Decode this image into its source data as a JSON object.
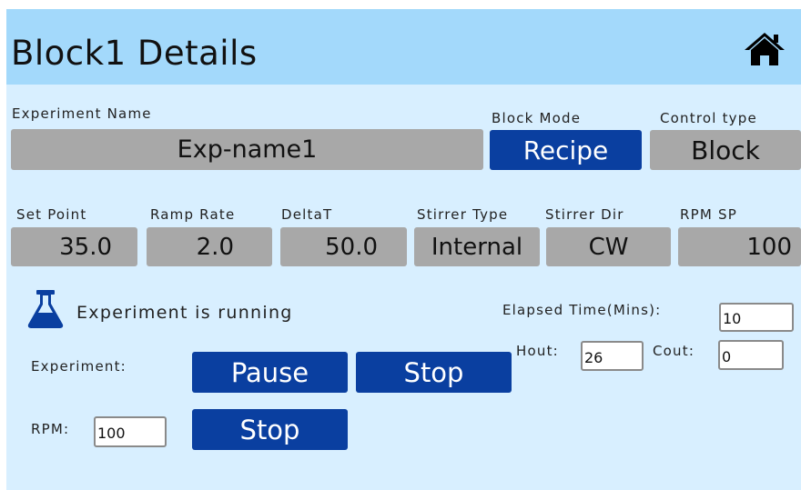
{
  "header": {
    "title": "Block1 Details"
  },
  "icons": {
    "home": "home-icon",
    "flask": "flask-icon"
  },
  "labels": {
    "experiment_name": "Experiment Name",
    "block_mode": "Block Mode",
    "control_type": "Control type",
    "set_point": "Set Point",
    "ramp_rate": "Ramp Rate",
    "delta_t": "DeltaT",
    "stirrer_type": "Stirrer Type",
    "stirrer_dir": "Stirrer Dir",
    "rpm_sp": "RPM SP",
    "elapsed_time": "Elapsed Time(Mins):",
    "hout": "Hout:",
    "cout": "Cout:",
    "experiment": "Experiment:",
    "rpm": "RPM:"
  },
  "values": {
    "experiment_name": "Exp-name1",
    "block_mode": "Recipe",
    "control_type": "Block",
    "set_point": "35.0",
    "ramp_rate": "2.0",
    "delta_t": "50.0",
    "stirrer_type": "Internal",
    "stirrer_dir": "CW",
    "rpm_sp": "100"
  },
  "status": {
    "text": "Experiment is running"
  },
  "inputs": {
    "elapsed_time": "10",
    "hout": "26",
    "cout": "0",
    "rpm": "100"
  },
  "buttons": {
    "pause": "Pause",
    "stop_experiment": "Stop",
    "stop_rpm": "Stop"
  },
  "colors": {
    "header_bg": "#a3d9fb",
    "page_bg": "#d8efff",
    "field_bg": "#a8a8a8",
    "button_bg": "#0a3fa0",
    "icon": "#0a3fa0"
  }
}
